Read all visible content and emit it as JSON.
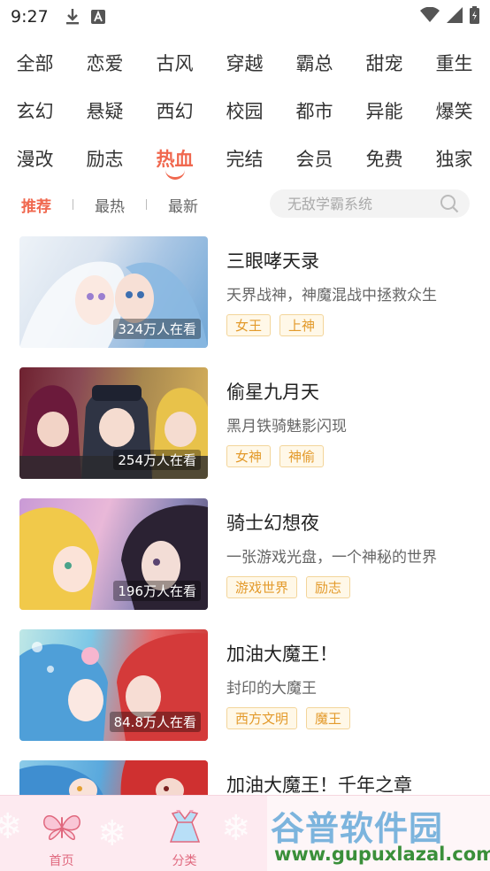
{
  "status": {
    "time": "9:27"
  },
  "categories": [
    [
      "全部",
      "恋爱",
      "古风",
      "穿越",
      "霸总",
      "甜宠",
      "重生"
    ],
    [
      "玄幻",
      "悬疑",
      "西幻",
      "校园",
      "都市",
      "异能",
      "爆笑"
    ],
    [
      "漫改",
      "励志",
      "热血",
      "完结",
      "会员",
      "免费",
      "独家"
    ]
  ],
  "active_category": "热血",
  "sort_tabs": [
    "推荐",
    "最热",
    "最新"
  ],
  "active_sort": "推荐",
  "search": {
    "placeholder": "无敌学霸系统"
  },
  "comics": [
    {
      "title": "三眼哮天录",
      "desc": "天界战神，神魔混战中拯救众生",
      "viewers": "324万人在看",
      "tags": [
        "女王",
        "上神"
      ]
    },
    {
      "title": "偷星九月天",
      "desc": "黑月铁骑魅影闪现",
      "viewers": "254万人在看",
      "tags": [
        "女神",
        "神偷"
      ]
    },
    {
      "title": "骑士幻想夜",
      "desc": "一张游戏光盘，一个神秘的世界",
      "viewers": "196万人在看",
      "tags": [
        "游戏世界",
        "励志"
      ]
    },
    {
      "title": "加油大魔王！",
      "desc": "封印的大魔王",
      "viewers": "84.8万人在看",
      "tags": [
        "西方文明",
        "魔王"
      ]
    },
    {
      "title": "加油大魔王！千年之章",
      "desc": "",
      "viewers": "",
      "tags": []
    }
  ],
  "bottom_nav": [
    {
      "label": "首页",
      "icon": "butterfly-icon"
    },
    {
      "label": "分类",
      "icon": "dress-icon"
    }
  ],
  "watermark": {
    "text": "谷普软件园",
    "url": "www.gupuxlazal.com"
  },
  "colors": {
    "accent": "#f0684f",
    "tag_text": "#e39a2b",
    "nav_bg": "#fdeaf0",
    "nav_label": "#e0687e"
  }
}
